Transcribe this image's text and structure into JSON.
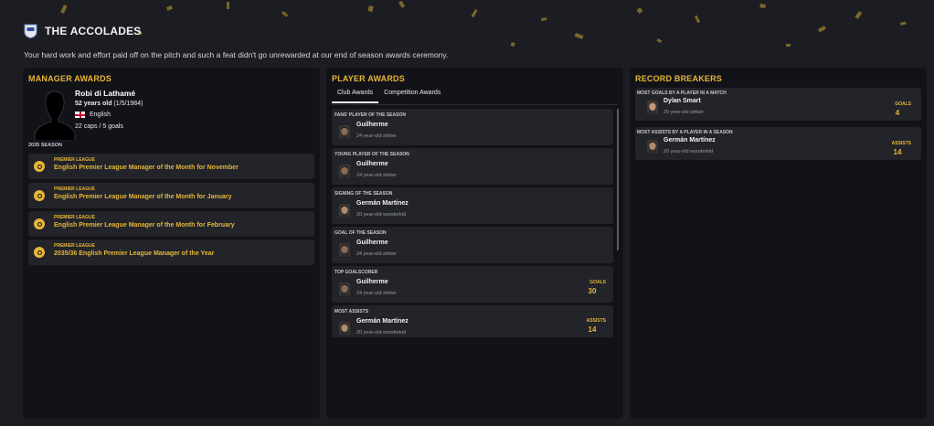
{
  "header": {
    "title": "THE ACCOLADES",
    "subtitle": "Your hard work and effort paid off on the pitch and such a feat didn't go unrewarded at our end of season awards ceremony."
  },
  "colors": {
    "accent": "#e7b639",
    "panel": "#121318",
    "card": "#22242a",
    "background": "#1b1d22"
  },
  "manager": {
    "title": "MANAGER AWARDS",
    "name": "Robi di Lathamé",
    "age": "52 years old",
    "dob": "(1/5/1984)",
    "nation": "English",
    "caps": "22 caps / 5 goals",
    "season": "2035 SEASON",
    "awards": [
      {
        "competition": "PREMIER LEAGUE",
        "name": "English Premier League Manager of the Month for November"
      },
      {
        "competition": "PREMIER LEAGUE",
        "name": "English Premier League Manager of the Month for January"
      },
      {
        "competition": "PREMIER LEAGUE",
        "name": "English Premier League Manager of the Month for February"
      },
      {
        "competition": "PREMIER LEAGUE",
        "name": "2035/36 English Premier League Manager of the Year"
      }
    ]
  },
  "player_awards": {
    "title": "PLAYER AWARDS",
    "tabs": [
      {
        "label": "Club Awards",
        "active": true
      },
      {
        "label": "Competition Awards",
        "active": false
      }
    ],
    "awards": [
      {
        "category": "FANS' PLAYER OF THE SEASON",
        "player": "Guilherme",
        "desc": "24 year-old striker",
        "stat_label": "",
        "stat_value": ""
      },
      {
        "category": "YOUNG PLAYER OF THE SEASON",
        "player": "Guilherme",
        "desc": "24 year-old striker",
        "stat_label": "",
        "stat_value": ""
      },
      {
        "category": "SIGNING OF THE SEASON",
        "player": "Germán Martínez",
        "desc": "20 year-old wonderkid",
        "stat_label": "",
        "stat_value": ""
      },
      {
        "category": "GOAL OF THE SEASON",
        "player": "Guilherme",
        "desc": "24 year-old striker",
        "stat_label": "",
        "stat_value": ""
      },
      {
        "category": "TOP GOALSCORER",
        "player": "Guilherme",
        "desc": "24 year-old striker",
        "stat_label": "GOALS",
        "stat_value": "30"
      },
      {
        "category": "MOST ASSISTS",
        "player": "Germán Martínez",
        "desc": "20 year-old wonderkid",
        "stat_label": "ASSISTS",
        "stat_value": "14"
      }
    ]
  },
  "records": {
    "title": "RECORD BREAKERS",
    "items": [
      {
        "category": "MOST GOALS BY A PLAYER IN A MATCH",
        "player": "Dylan Smart",
        "desc": "20 year-old striker",
        "stat_label": "GOALS",
        "stat_value": "4"
      },
      {
        "category": "MOST ASSISTS BY A PLAYER IN A SEASON",
        "player": "Germán Martínez",
        "desc": "20 year-old wonderkid",
        "stat_label": "ASSISTS",
        "stat_value": "14"
      }
    ]
  }
}
